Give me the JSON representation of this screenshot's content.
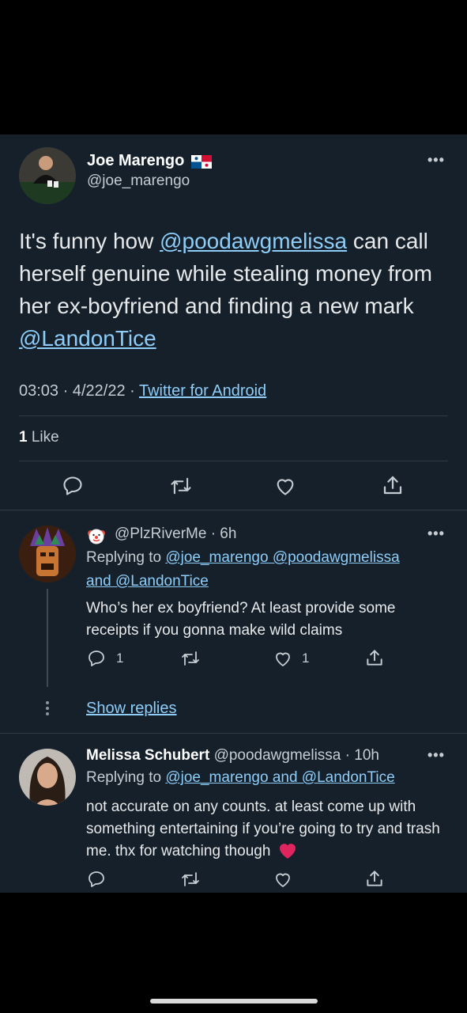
{
  "main_tweet": {
    "author_name": "Joe Marengo",
    "handle": "@joe_marengo",
    "text_parts": [
      "It's funny how ",
      "@poodawgmelissa",
      " can call herself genuine while stealing money from her ex-boyfriend and finding a new mark ",
      "@LandonTice"
    ],
    "time": "03:03",
    "date": "4/22/22",
    "source": "Twitter for Android",
    "likes_count": "1",
    "likes_label": "Like"
  },
  "reply1": {
    "handle": "@PlzRiverMe",
    "time": "· 6h",
    "replying_prefix": "Replying to",
    "replying_line1": "@joe_marengo @poodawgmelissa",
    "replying_line2": "and @LandonTice",
    "text": "Who’s her ex boyfriend? At least provide some receipts if you gonna make wild claims",
    "reply_count": "1",
    "like_count": "1",
    "show_replies": "Show replies"
  },
  "reply2": {
    "author_name": "Melissa Schubert",
    "handle": "@poodawgmelissa",
    "time": "· 10h",
    "replying_prefix": "Replying to",
    "replying_targets": "@joe_marengo and @LandonTice",
    "text": "not accurate on any counts. at least come up with something entertaining if you’re going to try and trash me. thx for watching though"
  },
  "more_glyph": "•••",
  "icons": [
    "flag-panama-icon",
    "more-icon",
    "reply-icon",
    "retweet-icon",
    "like-icon",
    "share-icon",
    "clown-emoji-icon",
    "heart-emoji-icon"
  ],
  "colors": {
    "background": "#15202b",
    "link": "#8ecdf8",
    "divider": "#2f3b47",
    "text": "#e7e9ea"
  }
}
